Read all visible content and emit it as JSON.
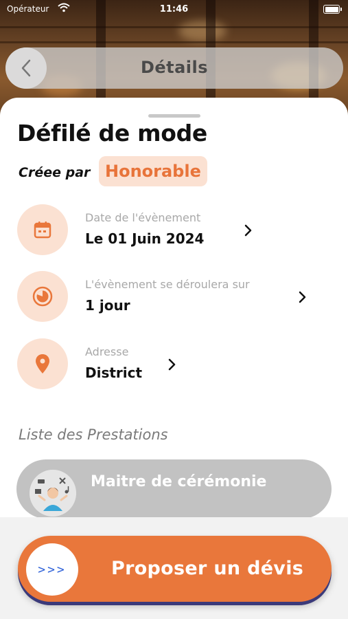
{
  "status_bar": {
    "carrier": "Opérateur",
    "time": "11:46"
  },
  "header": {
    "title": "Détails"
  },
  "event": {
    "title": "Défilé de mode",
    "created_by_label": "Créee par",
    "creator": "Honorable"
  },
  "details": [
    {
      "label": "Date de l'évènement",
      "value": "Le 01 Juin 2024",
      "icon": "calendar-icon"
    },
    {
      "label": "L'évènement se déroulera sur",
      "value": "1 jour",
      "icon": "clock-icon"
    },
    {
      "label": "Adresse",
      "value": "District",
      "icon": "location-pin-icon"
    }
  ],
  "prestations": {
    "title": "Liste des Prestations",
    "items": [
      {
        "label": "Maitre de cérémonie"
      }
    ]
  },
  "cta": {
    "label": "Proposer un dévis",
    "knob_glyph": ">>>"
  },
  "colors": {
    "accent": "#e9773b",
    "accent_light": "#fbe1d2",
    "cta_arrows": "#2f62d9"
  }
}
